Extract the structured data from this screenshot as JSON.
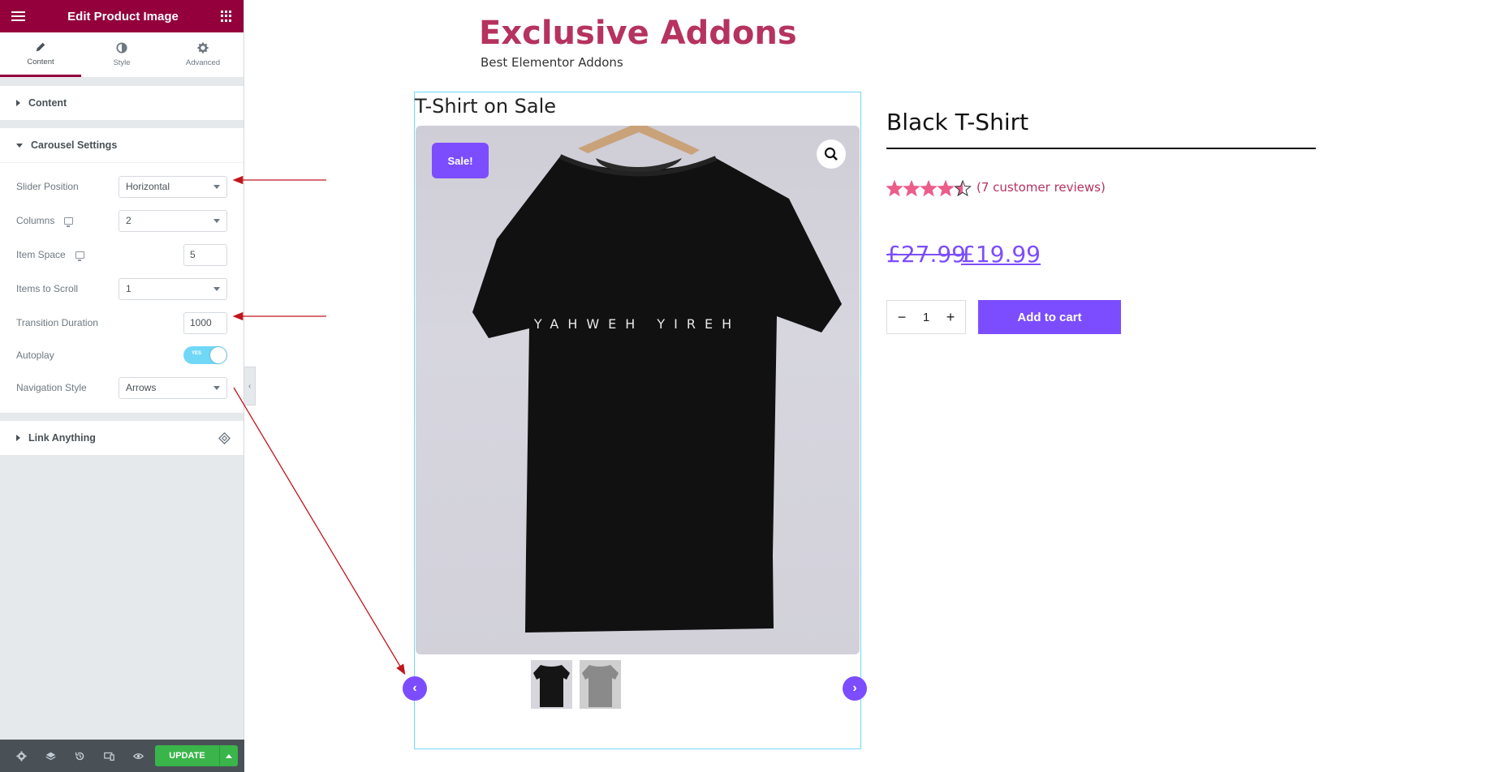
{
  "panel": {
    "title": "Edit Product Image",
    "tabs": [
      {
        "label": "Content",
        "icon": "pencil-icon"
      },
      {
        "label": "Style",
        "icon": "half-circle-icon"
      },
      {
        "label": "Advanced",
        "icon": "gear-icon"
      }
    ],
    "sections": {
      "content": {
        "title": "Content"
      },
      "carousel": {
        "title": "Carousel Settings",
        "controls": {
          "slider_position": {
            "label": "Slider Position",
            "value": "Horizontal"
          },
          "columns": {
            "label": "Columns",
            "value": "2"
          },
          "item_space": {
            "label": "Item Space",
            "value": "5"
          },
          "items_to_scroll": {
            "label": "Items to Scroll",
            "value": "1"
          },
          "transition_duration": {
            "label": "Transition Duration",
            "value": "1000"
          },
          "autoplay": {
            "label": "Autoplay",
            "toggle_text": "YES",
            "on": true
          },
          "navigation_style": {
            "label": "Navigation Style",
            "value": "Arrows"
          }
        }
      },
      "link_anything": {
        "title": "Link Anything"
      }
    },
    "footer": {
      "update_label": "UPDATE",
      "icons": [
        "settings-icon",
        "layers-icon",
        "history-icon",
        "responsive-icon",
        "eye-icon"
      ]
    }
  },
  "site": {
    "title": "Exclusive Addons",
    "tagline": "Best Elementor Addons"
  },
  "widget": {
    "heading": "T-Shirt on Sale",
    "sale_badge": "Sale!",
    "shirt_print": "YAHWEH YIREH"
  },
  "product": {
    "title": "Black T-Shirt",
    "rating": 4.5,
    "rating_max": 5,
    "reviews": "(7 customer reviews)",
    "price_old": "£27.99",
    "price_new": "£19.99",
    "quantity": "1",
    "add_to_cart": "Add to cart"
  },
  "colors": {
    "brand": "#93003c",
    "accent": "#7c4dff",
    "site_title": "#b5335e",
    "annotation_arrow": "#c0161c",
    "star": "#ec5d8a"
  }
}
